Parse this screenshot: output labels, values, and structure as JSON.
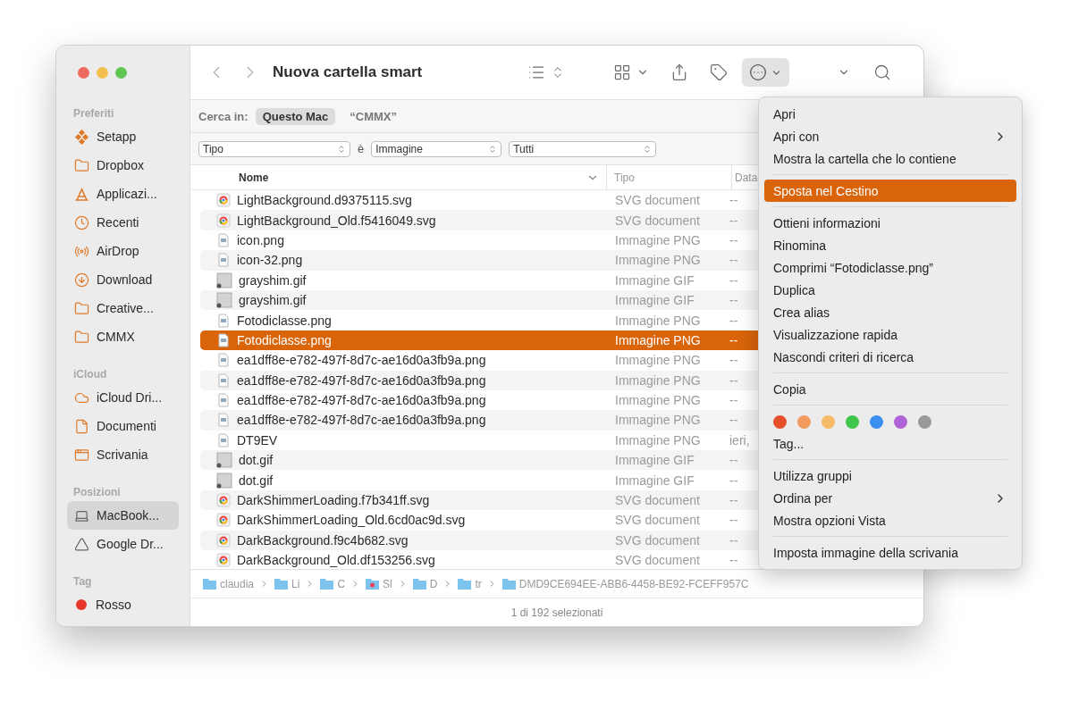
{
  "window": {
    "title": "Nuova cartella smart"
  },
  "sidebar": {
    "sections": [
      {
        "title": "Preferiti",
        "items": [
          {
            "label": "Setapp",
            "selected": false
          },
          {
            "label": "Dropbox",
            "selected": false
          },
          {
            "label": "Applicazi...",
            "selected": false
          },
          {
            "label": "Recenti",
            "selected": false
          },
          {
            "label": "AirDrop",
            "selected": false
          },
          {
            "label": "Download",
            "selected": false
          },
          {
            "label": "Creative...",
            "selected": false
          },
          {
            "label": "CMMX",
            "selected": false
          }
        ]
      },
      {
        "title": "iCloud",
        "items": [
          {
            "label": "iCloud Dri...",
            "selected": false
          },
          {
            "label": "Documenti",
            "selected": false
          },
          {
            "label": "Scrivania",
            "selected": false
          }
        ]
      },
      {
        "title": "Posizioni",
        "items": [
          {
            "label": "MacBook...",
            "selected": true
          },
          {
            "label": "Google Dr...",
            "selected": false
          }
        ]
      },
      {
        "title": "Tag",
        "items": [
          {
            "label": "Rosso",
            "color": "#e8382c",
            "selected": false
          }
        ]
      }
    ]
  },
  "search_scope": {
    "label": "Cerca in:",
    "options": [
      {
        "label": "Questo Mac",
        "selected": true
      },
      {
        "label": "“CMMX”",
        "selected": false
      }
    ]
  },
  "criteria": [
    {
      "kind": "select",
      "value": "Tipo"
    },
    {
      "kind": "text",
      "value": "è"
    },
    {
      "kind": "select",
      "value": "Immagine"
    },
    {
      "kind": "select",
      "value": "Tutti"
    }
  ],
  "columns": [
    {
      "label": "Nome",
      "sorted": true
    },
    {
      "label": "Tipo",
      "sorted": false
    },
    {
      "label": "Data",
      "sorted": false
    }
  ],
  "rows": [
    {
      "name": "LightBackground.d9375115.svg",
      "type": "SVG document",
      "date": "--",
      "kind": "svg",
      "selected": false
    },
    {
      "name": "LightBackground_Old.f5416049.svg",
      "type": "SVG document",
      "date": "--",
      "kind": "svg",
      "selected": false
    },
    {
      "name": "icon.png",
      "type": "Immagine PNG",
      "date": "--",
      "kind": "png",
      "selected": false
    },
    {
      "name": "icon-32.png",
      "type": "Immagine PNG",
      "date": "--",
      "kind": "png",
      "selected": false
    },
    {
      "name": "grayshim.gif",
      "type": "Immagine GIF",
      "date": "--",
      "kind": "gif",
      "selected": false
    },
    {
      "name": "grayshim.gif",
      "type": "Immagine GIF",
      "date": "--",
      "kind": "gif",
      "selected": false
    },
    {
      "name": "Fotodiclasse.png",
      "type": "Immagine PNG",
      "date": "--",
      "kind": "png",
      "selected": false
    },
    {
      "name": "Fotodiclasse.png",
      "type": "Immagine PNG",
      "date": "--",
      "kind": "png",
      "selected": true
    },
    {
      "name": "ea1dff8e-e782-497f-8d7c-ae16d0a3fb9a.png",
      "type": "Immagine PNG",
      "date": "--",
      "kind": "png",
      "selected": false
    },
    {
      "name": "ea1dff8e-e782-497f-8d7c-ae16d0a3fb9a.png",
      "type": "Immagine PNG",
      "date": "--",
      "kind": "png",
      "selected": false
    },
    {
      "name": "ea1dff8e-e782-497f-8d7c-ae16d0a3fb9a.png",
      "type": "Immagine PNG",
      "date": "--",
      "kind": "png",
      "selected": false
    },
    {
      "name": "ea1dff8e-e782-497f-8d7c-ae16d0a3fb9a.png",
      "type": "Immagine PNG",
      "date": "--",
      "kind": "png",
      "selected": false
    },
    {
      "name": "DT9EV",
      "type": "Immagine PNG",
      "date": "ieri,",
      "kind": "png",
      "selected": false
    },
    {
      "name": "dot.gif",
      "type": "Immagine GIF",
      "date": "--",
      "kind": "gif",
      "selected": false
    },
    {
      "name": "dot.gif",
      "type": "Immagine GIF",
      "date": "--",
      "kind": "gif",
      "selected": false
    },
    {
      "name": "DarkShimmerLoading.f7b341ff.svg",
      "type": "SVG document",
      "date": "--",
      "kind": "svg",
      "selected": false
    },
    {
      "name": "DarkShimmerLoading_Old.6cd0ac9d.svg",
      "type": "SVG document",
      "date": "--",
      "kind": "svg",
      "selected": false
    },
    {
      "name": "DarkBackground.f9c4b682.svg",
      "type": "SVG document",
      "date": "--",
      "kind": "svg",
      "selected": false
    },
    {
      "name": "DarkBackground_Old.df153256.svg",
      "type": "SVG document",
      "date": "--",
      "kind": "svg",
      "selected": false
    }
  ],
  "path_bar": [
    "claudia",
    "Li",
    "C",
    "Sl",
    "D",
    "tr",
    "DMD9CE694EE-ABB6-4458-BE92-FCEFF957C"
  ],
  "status_bar": "1 di 192 selezionati",
  "context_menu": {
    "groups": [
      {
        "kind": "items",
        "items": [
          {
            "label": "Apri",
            "submenu": false,
            "highlighted": false
          },
          {
            "label": "Apri con",
            "submenu": true,
            "highlighted": false
          },
          {
            "label": "Mostra la cartella che lo contiene",
            "submenu": false,
            "highlighted": false
          }
        ]
      },
      {
        "kind": "items",
        "items": [
          {
            "label": "Sposta nel Cestino",
            "submenu": false,
            "highlighted": true
          }
        ]
      },
      {
        "kind": "items",
        "items": [
          {
            "label": "Ottieni informazioni",
            "submenu": false,
            "highlighted": false
          },
          {
            "label": "Rinomina",
            "submenu": false,
            "highlighted": false
          },
          {
            "label": "Comprimi “Fotodiclasse.png”",
            "submenu": false,
            "highlighted": false
          },
          {
            "label": "Duplica",
            "submenu": false,
            "highlighted": false
          },
          {
            "label": "Crea alias",
            "submenu": false,
            "highlighted": false
          },
          {
            "label": "Visualizzazione rapida",
            "submenu": false,
            "highlighted": false
          },
          {
            "label": "Nascondi criteri di ricerca",
            "submenu": false,
            "highlighted": false
          }
        ]
      },
      {
        "kind": "items",
        "items": [
          {
            "label": "Copia",
            "submenu": false,
            "highlighted": false
          }
        ]
      },
      {
        "kind": "tags",
        "colors": [
          {
            "color": "#e5502a"
          },
          {
            "color": "#f19a5e"
          },
          {
            "color": "#f7bb67"
          },
          {
            "color": "#3fc54b"
          },
          {
            "color": "#3a8ff0"
          },
          {
            "color": "#b063d6"
          },
          {
            "color": "#9a9a9a"
          }
        ],
        "items": [
          {
            "label": "Tag...",
            "submenu": false,
            "highlighted": false
          }
        ]
      },
      {
        "kind": "items",
        "items": [
          {
            "label": "Utilizza gruppi",
            "submenu": false,
            "highlighted": false
          },
          {
            "label": "Ordina per",
            "submenu": true,
            "highlighted": false
          },
          {
            "label": "Mostra opzioni Vista",
            "submenu": false,
            "highlighted": false
          }
        ]
      },
      {
        "kind": "items",
        "items": [
          {
            "label": "Imposta immagine della scrivania",
            "submenu": false,
            "highlighted": false
          }
        ]
      }
    ]
  }
}
